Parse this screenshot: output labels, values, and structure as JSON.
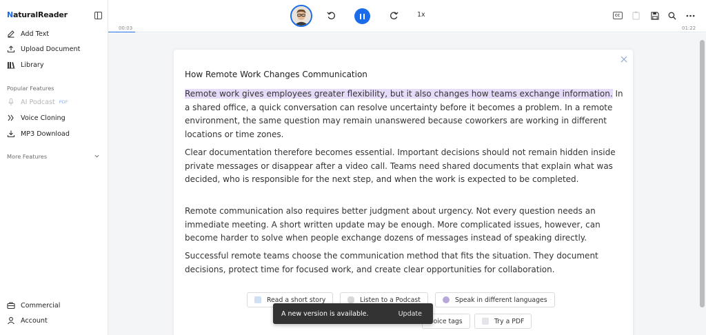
{
  "app": {
    "logo_first": "N",
    "logo_rest": "aturalReader"
  },
  "sidebar": {
    "top_items": [
      {
        "label": "Add Text",
        "icon": "edit-icon"
      },
      {
        "label": "Upload Document",
        "icon": "upload-icon"
      },
      {
        "label": "Library",
        "icon": "library-icon"
      }
    ],
    "popular_label": "Popular Features",
    "popular_items": [
      {
        "label": "AI Podcast",
        "badge": "PDF",
        "icon": "microphone-icon",
        "disabled": true
      },
      {
        "label": "Voice Cloning",
        "icon": "voice-wave-icon"
      },
      {
        "label": "MP3 Download",
        "icon": "download-icon"
      }
    ],
    "more_label": "More Features",
    "bottom_items": [
      {
        "label": "Commercial",
        "icon": "briefcase-icon"
      },
      {
        "label": "Account",
        "icon": "user-icon"
      }
    ]
  },
  "player": {
    "elapsed": "00:03",
    "total": "01:22",
    "progress": 0.045,
    "speed": "1x",
    "accent": "#1a6ce8"
  },
  "document": {
    "title": "How Remote Work Changes Communication",
    "p1_highlight": "Remote work gives employees greater flexibility, but it also changes how teams exchange information.",
    "p1_rest": " In a shared office, a quick conversation can resolve uncertainty before it becomes a problem. In a remote environment, the same question may remain unanswered because coworkers are working in different locations or time zones.",
    "p2": "Clear documentation therefore becomes essential. Important decisions should not remain hidden inside private messages or disappear after a video call. Teams need shared documents that explain what was decided, who is responsible for the next step, and when the work is expected to be completed.",
    "p3": "Remote communication also requires better judgment about urgency. Not every question needs an immediate meeting. A short written update may be enough. More complicated issues, however, can become harder to solve when people exchange dozens of messages instead of speaking directly.",
    "p4": "Successful remote teams choose the communication method that fits the situation. They document decisions, protect time for focused work, and create clear opportunities for collaboration.",
    "highlight_color": "#e6dcfa"
  },
  "suggestions": [
    {
      "label": "Read a short story"
    },
    {
      "label": "Listen to a Podcast"
    },
    {
      "label": "Speak in different languages"
    },
    {
      "label": "voice tags"
    },
    {
      "label": "Try a PDF"
    }
  ],
  "toast": {
    "message": "A new version is available.",
    "action": "Update"
  }
}
